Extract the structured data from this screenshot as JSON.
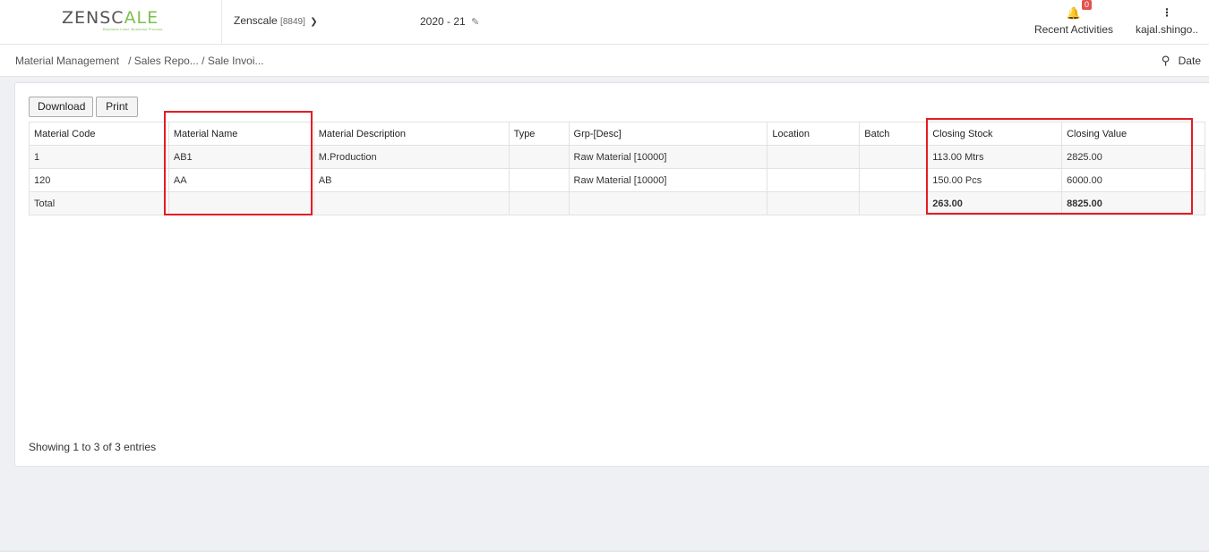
{
  "brand": {
    "logo_part1": "ZENSC",
    "logo_part2": "ALE",
    "tagline": "Business Lead. Business Process."
  },
  "header": {
    "company_name": "Zenscale",
    "company_code": "[8849]",
    "year": "2020 - 21",
    "notification_count": "0",
    "recent_activities": "Recent Activities",
    "username": "kajal.shingo.."
  },
  "breadcrumb": [
    {
      "label": "Material Management"
    },
    {
      "label": "Sales Repo..."
    },
    {
      "label": "Sale Invoi..."
    }
  ],
  "filter": {
    "date_label": "Date"
  },
  "toolbar": {
    "download_label": "Download",
    "print_label": "Print"
  },
  "table": {
    "headers": [
      "Material Code",
      "Material Name",
      "Material Description",
      "Type",
      "Grp-[Desc]",
      "Location",
      "Batch",
      "Closing Stock",
      "Closing Value"
    ],
    "rows": [
      [
        "1",
        "AB1",
        "M.Production",
        "",
        "Raw Material [10000]",
        "",
        "",
        "113.00 Mtrs",
        "2825.00"
      ],
      [
        "120",
        "AA",
        "AB",
        "",
        "Raw Material [10000]",
        "",
        "",
        "150.00 Pcs",
        "6000.00"
      ]
    ],
    "total": {
      "label": "Total",
      "closing_stock": "263.00",
      "closing_value": "8825.00"
    }
  },
  "footer": {
    "entries_text": "Showing 1 to 3 of 3 entries"
  },
  "colors": {
    "brand_green": "#7cc04b",
    "highlight_red": "#e51c23",
    "badge_red": "#e3524f"
  }
}
